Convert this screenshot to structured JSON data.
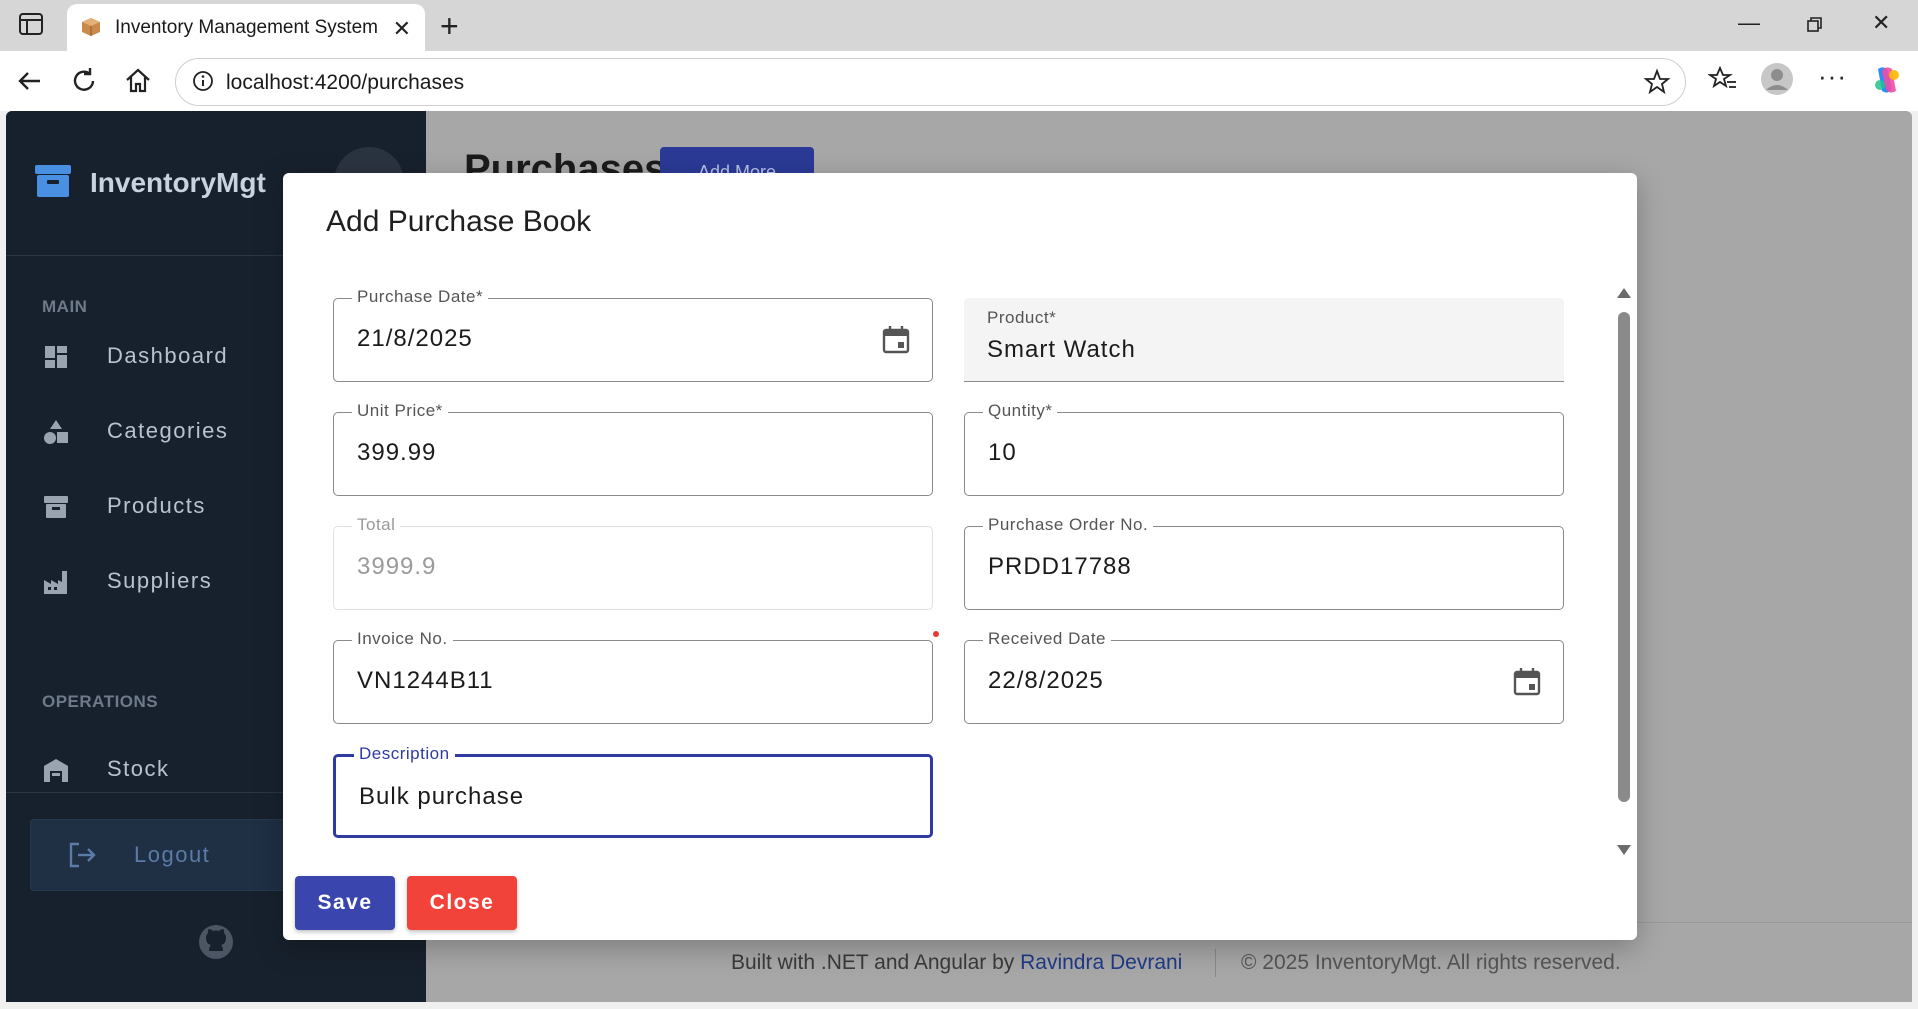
{
  "browser": {
    "tab_title": "Inventory Management System",
    "url": "localhost:4200/purchases"
  },
  "sidebar": {
    "brand": "InventoryMgt",
    "sections": {
      "main": "MAIN",
      "operations": "OPERATIONS"
    },
    "items": [
      {
        "label": "Dashboard",
        "icon": "dashboard-icon"
      },
      {
        "label": "Categories",
        "icon": "category-icon"
      },
      {
        "label": "Products",
        "icon": "archive-icon"
      },
      {
        "label": "Suppliers",
        "icon": "factory-icon"
      },
      {
        "label": "Stock",
        "icon": "warehouse-icon"
      }
    ],
    "logout": "Logout"
  },
  "content": {
    "title": "Purchases",
    "add_more": "Add More"
  },
  "footer": {
    "built_prefix": "Built with .NET and Angular by",
    "author": "Ravindra Devrani",
    "copyright": "© 2025 InventoryMgt. All rights reserved."
  },
  "dialog": {
    "title": "Add Purchase Book",
    "fields": {
      "purchase_date": {
        "label": "Purchase Date*",
        "value": "21/8/2025"
      },
      "product": {
        "label": "Product*",
        "value": "Smart Watch"
      },
      "unit_price": {
        "label": "Unit Price*",
        "value": "399.99"
      },
      "quantity": {
        "label": "Quntity*",
        "value": "10"
      },
      "total": {
        "label": "Total",
        "value": "3999.9"
      },
      "purchase_order_no": {
        "label": "Purchase Order No.",
        "value": "PRDD17788"
      },
      "invoice_no": {
        "label": "Invoice No.",
        "value": "VN1244B11"
      },
      "received_date": {
        "label": "Received Date",
        "value": "22/8/2025"
      },
      "description": {
        "label": "Description",
        "value": "Bulk purchase"
      }
    },
    "save": "Save",
    "close": "Close"
  },
  "colors": {
    "sidebar_bg": "#17212d",
    "primary": "#3a45ad",
    "danger": "#f2433a",
    "focus": "#2f3ba3"
  }
}
